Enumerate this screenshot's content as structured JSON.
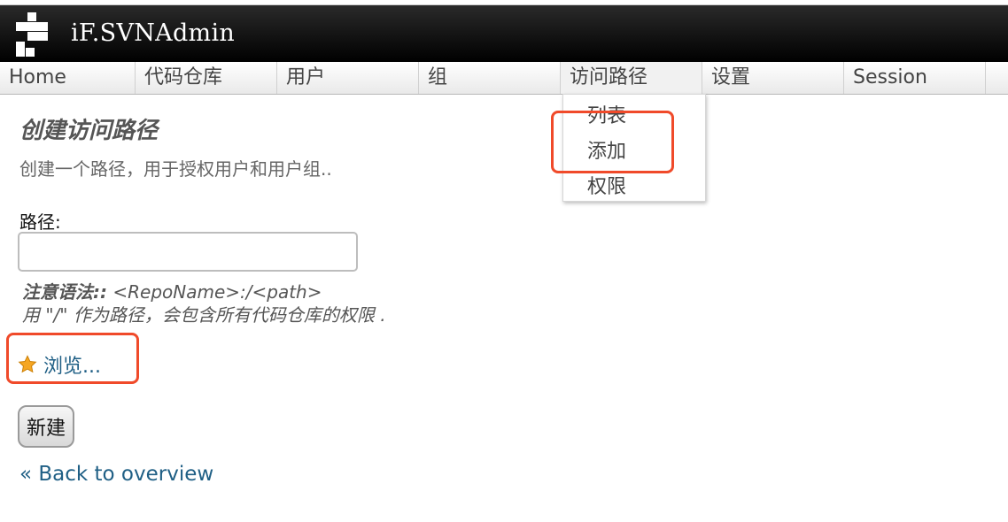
{
  "app": {
    "title": "iF.SVNAdmin"
  },
  "nav": {
    "items": [
      {
        "label": "Home"
      },
      {
        "label": "代码仓库"
      },
      {
        "label": "用户"
      },
      {
        "label": "组"
      },
      {
        "label": "访问路径"
      },
      {
        "label": "设置"
      },
      {
        "label": "Session"
      }
    ],
    "active": "访问路径"
  },
  "dropdown": {
    "items": [
      {
        "label": "列表"
      },
      {
        "label": "添加"
      },
      {
        "label": "权限"
      }
    ]
  },
  "page": {
    "title": "创建访问路径",
    "description": "创建一个路径，用于授权用户和用户组..",
    "path_label": "路径:",
    "path_value": "",
    "hint_bold": "注意语法::",
    "hint_syntax": " <RepoName>:/<path>",
    "hint_line2": "用 \"/\" 作为路径，会包含所有代码仓库的权限 .",
    "browse_label": "浏览...",
    "create_label": "新建",
    "back_label": "« Back to overview"
  },
  "colors": {
    "header_bg": "#000000",
    "link": "#1f5f85",
    "annotation": "#f04a2a"
  },
  "icons": {
    "logo": "svnadmin-logo-icon",
    "browse": "star-icon"
  }
}
